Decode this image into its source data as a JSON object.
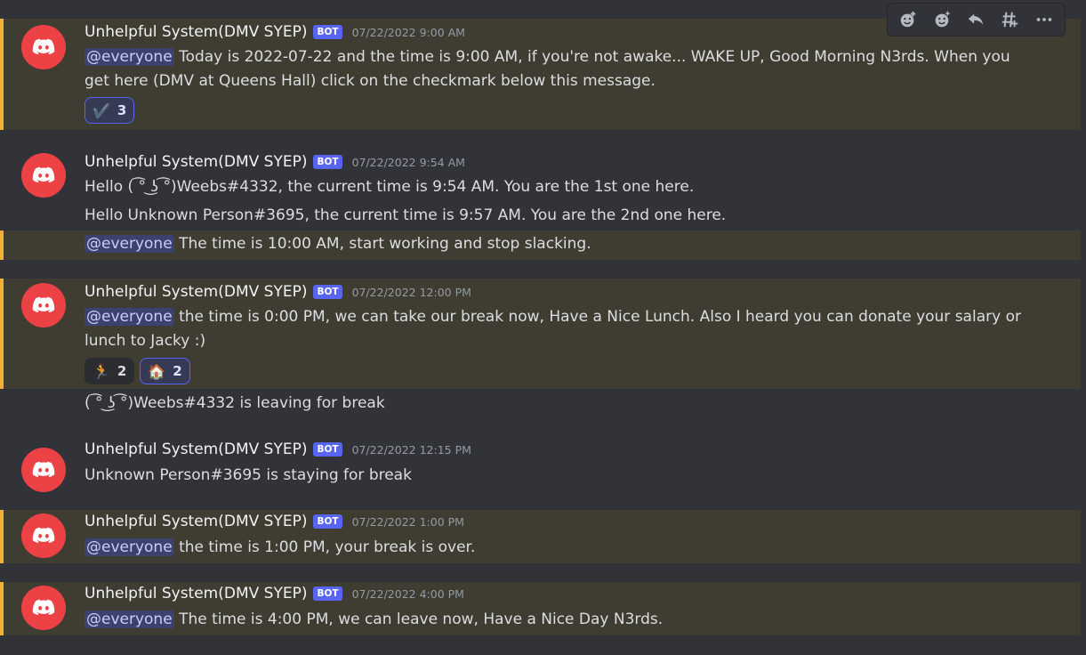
{
  "colors": {
    "background": "#313338",
    "mention_bg": "#3f3c31",
    "mention_bar": "#f0b232",
    "bot_tag": "#5865f2",
    "avatar": "#ed4245"
  },
  "toolbar": {
    "icons": [
      "add-reaction-icon",
      "super-reaction-icon",
      "reply-icon",
      "create-thread-icon",
      "more-icon"
    ]
  },
  "messages": [
    {
      "username": "Unhelpful System(DMV SYEP)",
      "bot": "BOT",
      "time": "07/22/2022 9:00 AM",
      "mention": "@everyone",
      "text": " Today is 2022-07-22 and the time is 9:00 AM, if you're not awake... WAKE UP, Good Morning N3rds. When you get here (DMV at Queens Hall) click on the checkmark below this message.",
      "reactions": [
        {
          "emoji": "✔️",
          "count": "3"
        }
      ]
    },
    {
      "username": "Unhelpful System(DMV SYEP)",
      "bot": "BOT",
      "time": "07/22/2022 9:54 AM",
      "text": "Hello ( ͡° ͜ʖ ͡°)Weebs#4332, the current time is 9:54 AM. You are the 1st one here."
    },
    {
      "text": "Hello Unknown Person#3695, the current time is 9:57 AM. You are the 2nd one here."
    },
    {
      "mention": "@everyone",
      "text": " The time is 10:00 AM, start working and stop slacking."
    },
    {
      "username": "Unhelpful System(DMV SYEP)",
      "bot": "BOT",
      "time": "07/22/2022 12:00 PM",
      "mention": "@everyone",
      "text": " the time is 0:00 PM, we can take our break now, Have a Nice Lunch. Also I heard you can donate your salary or lunch to Jacky :)",
      "reactions": [
        {
          "emoji": "🏃",
          "count": "2"
        },
        {
          "emoji": "🏠",
          "count": "2"
        }
      ]
    },
    {
      "text": "( ͡° ͜ʖ ͡°)Weebs#4332 is leaving for break"
    },
    {
      "username": "Unhelpful System(DMV SYEP)",
      "bot": "BOT",
      "time": "07/22/2022 12:15 PM",
      "text": "Unknown Person#3695 is staying for break"
    },
    {
      "username": "Unhelpful System(DMV SYEP)",
      "bot": "BOT",
      "time": "07/22/2022 1:00 PM",
      "mention": "@everyone",
      "text": " the time is 1:00 PM, your break is over."
    },
    {
      "username": "Unhelpful System(DMV SYEP)",
      "bot": "BOT",
      "time": "07/22/2022 4:00 PM",
      "mention": "@everyone",
      "text": " The time is 4:00 PM, we can leave now, Have a Nice Day N3rds."
    }
  ]
}
